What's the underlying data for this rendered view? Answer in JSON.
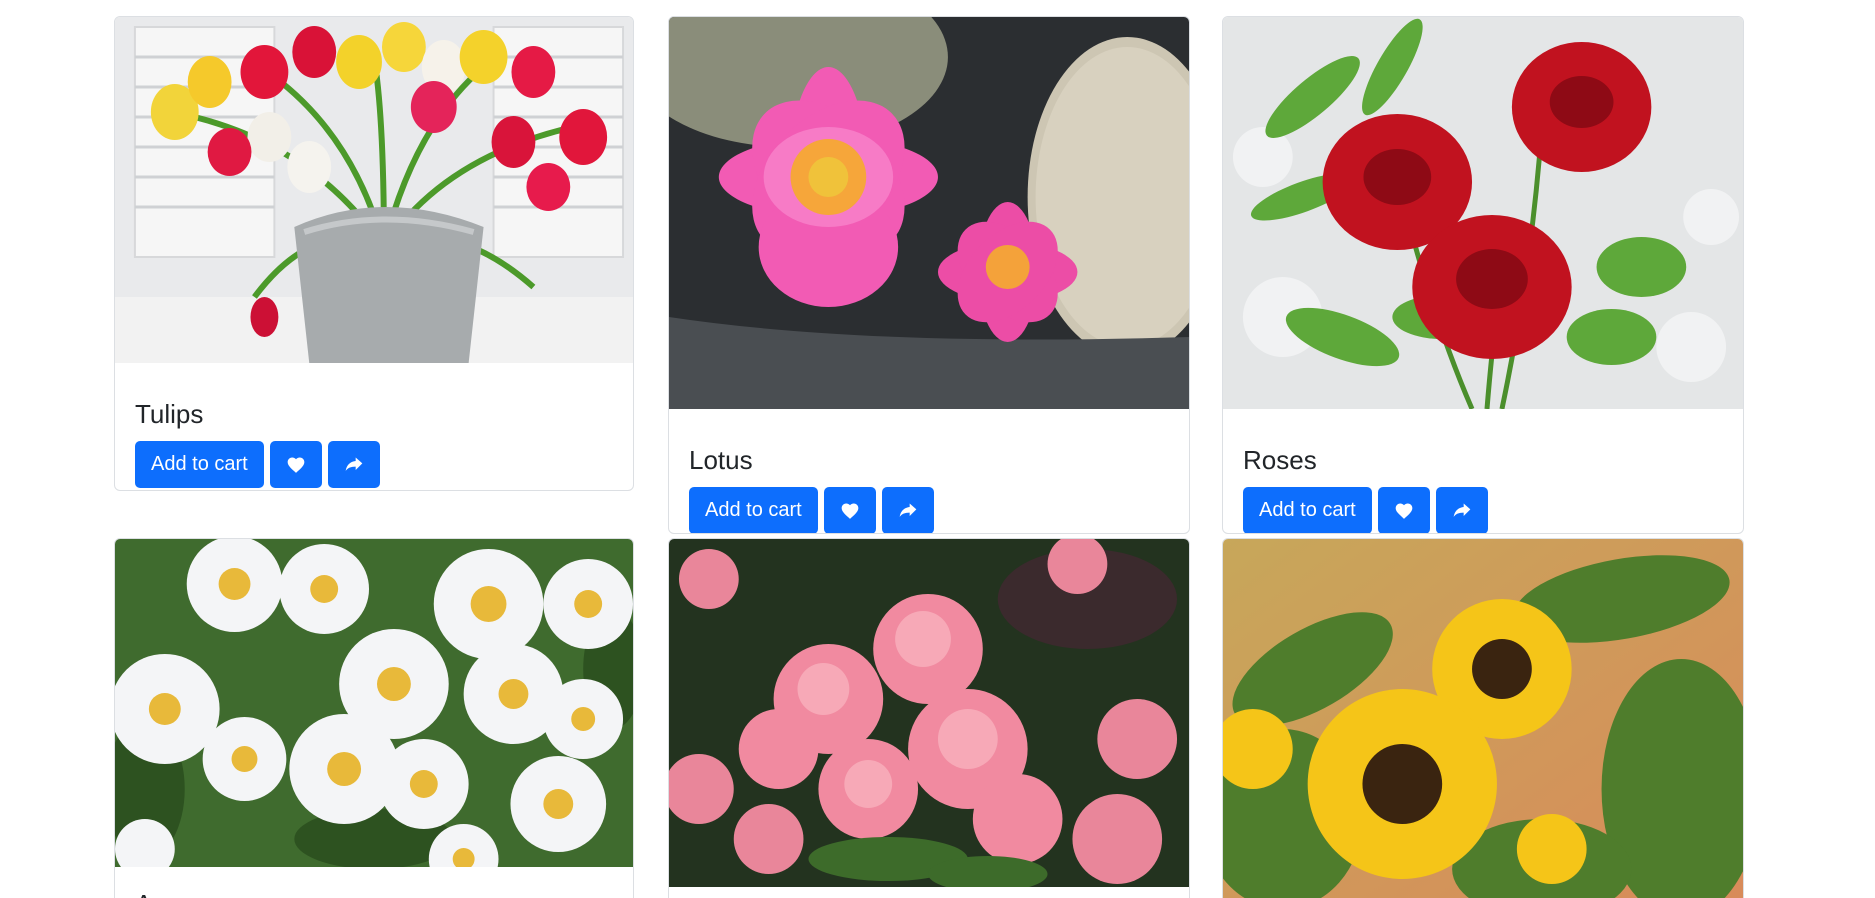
{
  "cards": [
    {
      "title": "Tulips",
      "add_to_cart": "Add to cart",
      "image": "tulips-in-bucket"
    },
    {
      "title": "Lotus",
      "add_to_cart": "Add to cart",
      "image": "pink-lotus-flowers"
    },
    {
      "title": "Roses",
      "add_to_cart": "Add to cart",
      "image": "red-roses"
    },
    {
      "title": "Anemone",
      "image": "white-anemones"
    },
    {
      "title": "",
      "image": "pink-azaleas"
    },
    {
      "title": "",
      "image": "sunflowers"
    }
  ],
  "icons": {
    "like": "heart-icon",
    "share": "share-icon"
  },
  "colors": {
    "primary": "#0d6efd"
  }
}
